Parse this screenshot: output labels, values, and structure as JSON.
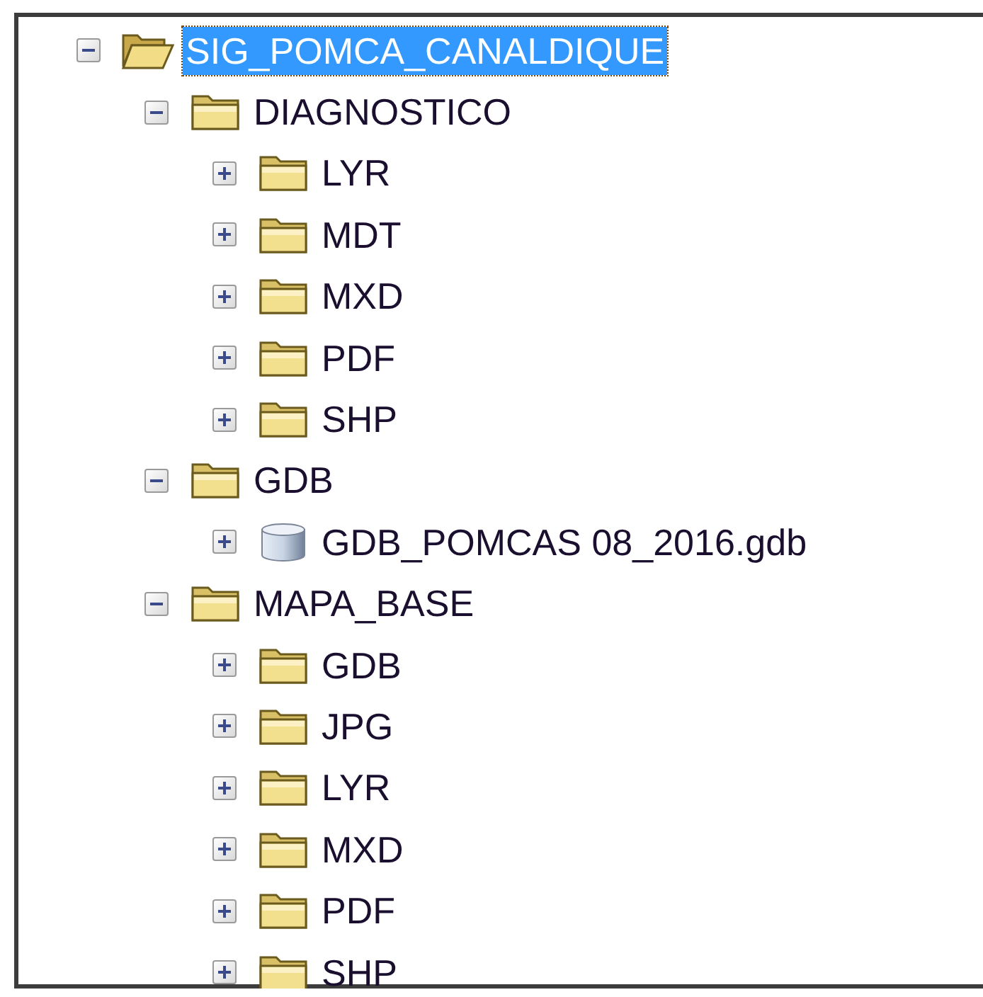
{
  "tree": [
    {
      "label": "SIG_POMCA_CANALDIQUE",
      "kind": "open-folder",
      "expanded": true,
      "selected": true,
      "children": [
        {
          "label": "DIAGNOSTICO",
          "kind": "folder",
          "expanded": true,
          "selected": false,
          "children": [
            {
              "label": "LYR",
              "kind": "folder",
              "expanded": false,
              "selected": false
            },
            {
              "label": "MDT",
              "kind": "folder",
              "expanded": false,
              "selected": false
            },
            {
              "label": "MXD",
              "kind": "folder",
              "expanded": false,
              "selected": false
            },
            {
              "label": "PDF",
              "kind": "folder",
              "expanded": false,
              "selected": false
            },
            {
              "label": "SHP",
              "kind": "folder",
              "expanded": false,
              "selected": false
            }
          ]
        },
        {
          "label": "GDB",
          "kind": "folder",
          "expanded": true,
          "selected": false,
          "children": [
            {
              "label": "GDB_POMCAS 08_2016.gdb",
              "kind": "database",
              "expanded": false,
              "selected": false
            }
          ]
        },
        {
          "label": "MAPA_BASE",
          "kind": "folder",
          "expanded": true,
          "selected": false,
          "children": [
            {
              "label": "GDB",
              "kind": "folder",
              "expanded": false,
              "selected": false
            },
            {
              "label": "JPG",
              "kind": "folder",
              "expanded": false,
              "selected": false
            },
            {
              "label": "LYR",
              "kind": "folder",
              "expanded": false,
              "selected": false
            },
            {
              "label": "MXD",
              "kind": "folder",
              "expanded": false,
              "selected": false
            },
            {
              "label": "PDF",
              "kind": "folder",
              "expanded": false,
              "selected": false
            },
            {
              "label": "SHP",
              "kind": "folder",
              "expanded": false,
              "selected": false
            }
          ]
        }
      ]
    }
  ]
}
